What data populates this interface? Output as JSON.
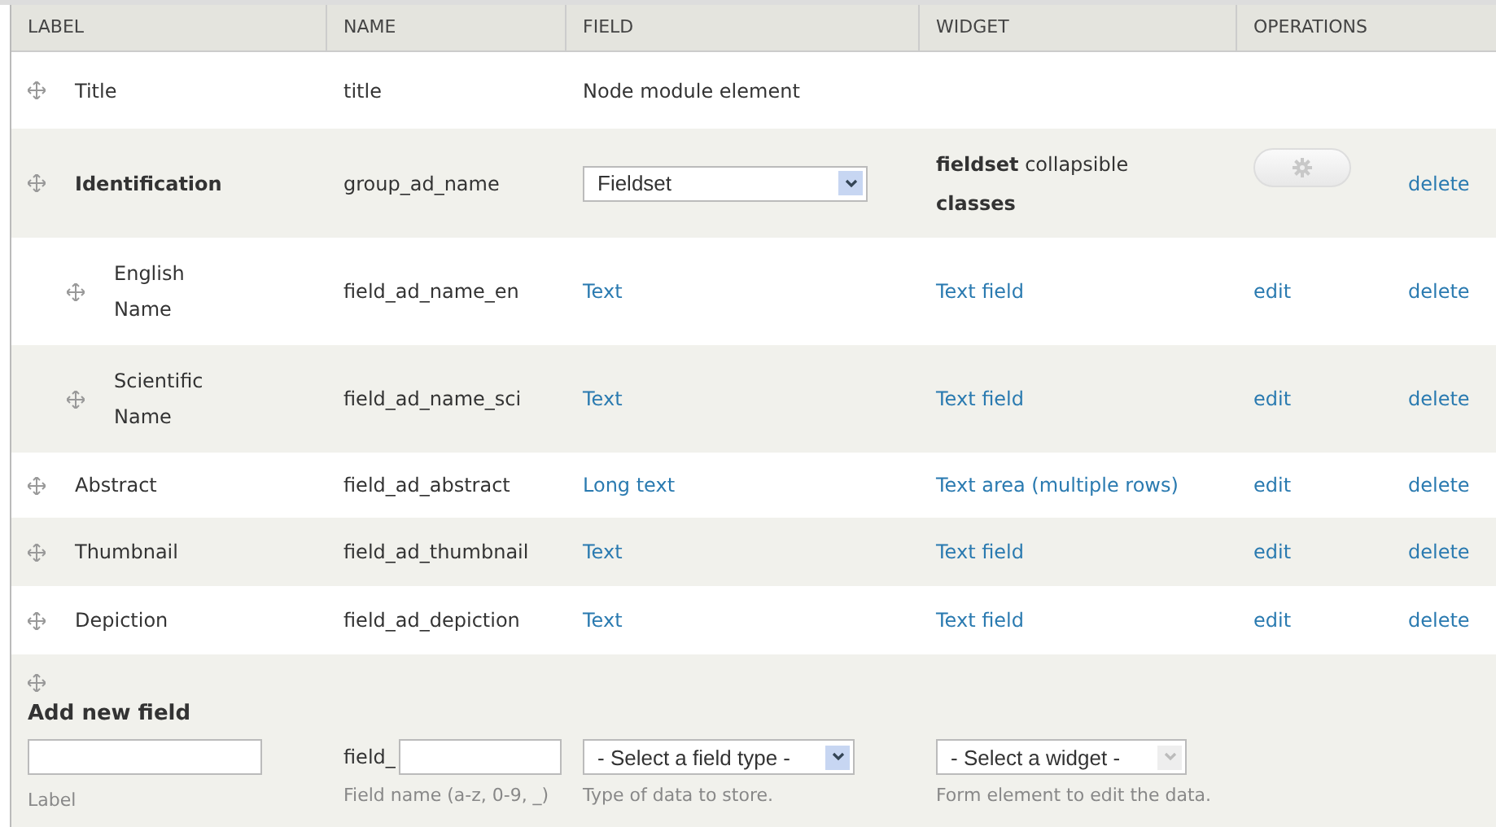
{
  "table": {
    "columns": [
      "LABEL",
      "NAME",
      "FIELD",
      "WIDGET",
      "OPERATIONS"
    ],
    "rows": [
      {
        "label": "Title",
        "name": "title",
        "field": {
          "kind": "text",
          "value": "Node module element"
        }
      },
      {
        "label": "Identification",
        "kind": "group",
        "name": "group_ad_name",
        "field": {
          "kind": "select",
          "value": "Fieldset"
        },
        "widget": {
          "kind": "text",
          "value": "**fieldset** collapsible **classes**"
        },
        "operations": [
          {
            "kind": "gear"
          },
          {
            "kind": "link",
            "label": "delete"
          }
        ],
        "children": [
          {
            "label": "English Name",
            "name": "field_ad_name_en",
            "field": {
              "kind": "link",
              "value": "Text"
            },
            "widget": {
              "kind": "link",
              "value": "Text field"
            },
            "operations": [
              {
                "kind": "link",
                "label": "edit"
              },
              {
                "kind": "link",
                "label": "delete"
              }
            ]
          },
          {
            "label": "Scientific Name",
            "name": "field_ad_name_sci",
            "field": {
              "kind": "link",
              "value": "Text"
            },
            "widget": {
              "kind": "link",
              "value": "Text field"
            },
            "operations": [
              {
                "kind": "link",
                "label": "edit"
              },
              {
                "kind": "link",
                "label": "delete"
              }
            ]
          }
        ]
      },
      {
        "label": "Abstract",
        "name": "field_ad_abstract",
        "field": {
          "kind": "link",
          "value": "Long text"
        },
        "widget": {
          "kind": "link",
          "value": "Text area (multiple rows)"
        },
        "operations": [
          {
            "kind": "link",
            "label": "edit"
          },
          {
            "kind": "link",
            "label": "delete"
          }
        ]
      },
      {
        "label": "Thumbnail",
        "name": "field_ad_thumbnail",
        "field": {
          "kind": "link",
          "value": "Text"
        },
        "widget": {
          "kind": "link",
          "value": "Text field"
        },
        "operations": [
          {
            "kind": "link",
            "label": "edit"
          },
          {
            "kind": "link",
            "label": "delete"
          }
        ]
      },
      {
        "label": "Depiction",
        "name": "field_ad_depiction",
        "field": {
          "kind": "link",
          "value": "Text"
        },
        "widget": {
          "kind": "link",
          "value": "Text field"
        },
        "operations": [
          {
            "kind": "link",
            "label": "edit"
          },
          {
            "kind": "link",
            "label": "delete"
          }
        ]
      }
    ]
  },
  "add_new_field": {
    "title": "Add new field",
    "label_hint": "Label",
    "name_prefix": "field_",
    "name_hint": "Field name (a-z, 0-9, _)",
    "field_type": {
      "value": "- Select a field type -",
      "hint": "Type of data to store.",
      "disabled": false
    },
    "widget": {
      "value": "- Select a widget -",
      "hint": "Form element to edit the data.",
      "disabled": true
    }
  }
}
